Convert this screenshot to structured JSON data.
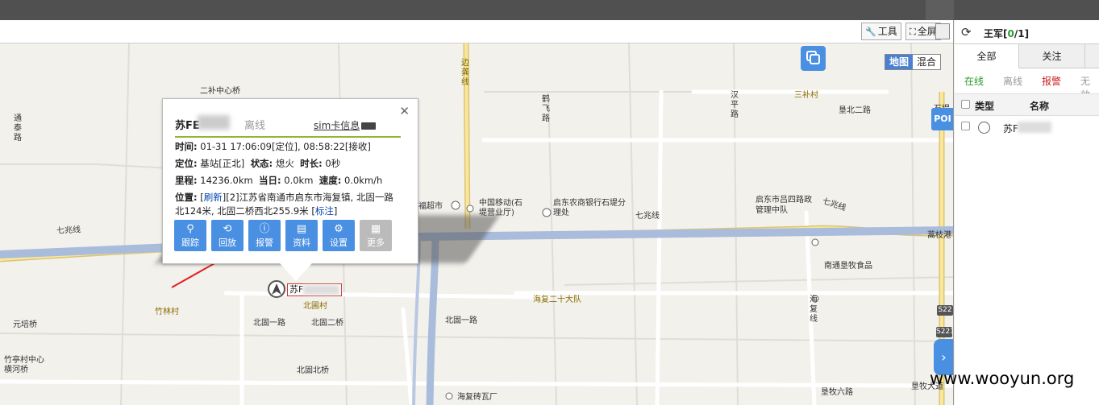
{
  "toolbar": {
    "tools_label": "工具",
    "fullscreen_label": "全屏"
  },
  "map": {
    "maptype_options": [
      "地图",
      "混合"
    ],
    "poi_label": "POI",
    "places": {
      "erbu_bridge": "二补中心桥",
      "tongtai_road": "通泰路",
      "bianyong_line": "边龚线",
      "hefei_road": "鹤飞路",
      "hanping_road": "汉平路",
      "sanbu_village": "三补村",
      "kenbei_2nd_road": "垦北二路",
      "shiti": "石堤",
      "fuchao_city": "福超市",
      "china_mobile": "中国移动(石堤营业厅)",
      "qidong_rural": "启东农商银行石堤分理处",
      "qidong_lvsi": "启东市吕四路政管理中队",
      "qizhao_line_1": "七兆线",
      "qizhao_line_2": "七兆线",
      "qizhao_line_3": "七兆线",
      "genzhi_port": "蒿枝港",
      "nantong_food": "南通垦牧食品",
      "zhulin_village": "竹林村",
      "beiguo_village": "北圃村",
      "haifu_team": "海复二十大队",
      "haifu_line": "海复线",
      "yuanpei_bridge": "元培桥",
      "beiguo_1st_a": "北固一路",
      "beiguo_2nd_bridge": "北固二桥",
      "beiguo_1st_b": "北固一路",
      "zhuting_village": "竹亭村中心横河桥",
      "beiguo_north_bridge": "北固北桥",
      "haifu_brick": "海复砖瓦厂",
      "kenmu_6th_road": "垦牧六路",
      "kenmu_ave": "垦牧大道"
    },
    "shields": [
      "S22",
      "S221"
    ],
    "marker_label": "苏F"
  },
  "popup": {
    "name": "苏FE",
    "status": "离线",
    "sim_label": "sim卡信息",
    "time_key": "时间:",
    "time_value": "01-31 17:06:09[定位], 08:58:22[接收]",
    "locate_key": "定位:",
    "locate_value": "基站[正北]",
    "state_key": "状态:",
    "state_value": "熄火",
    "duration_key": "时长:",
    "duration_value": "0秒",
    "mileage_key": "里程:",
    "mileage_value": "14236.0km",
    "today_key": "当日:",
    "today_value": "0.0km",
    "speed_key": "速度:",
    "speed_value": "0.0km/h",
    "position_key": "位置:",
    "refresh_label": "刷新",
    "position_value_1": "[2]江苏省南通市启东市海复镇, 北固一路",
    "position_value_2": "北124米, 北固二桥西北255.9米",
    "mark_label": "标注",
    "actions": [
      "跟踪",
      "回放",
      "报警",
      "资料",
      "设置",
      "更多"
    ]
  },
  "panel": {
    "user": "王军",
    "count_online": "0",
    "count_total": "1",
    "tabs": [
      "全部",
      "关注"
    ],
    "filters": [
      {
        "label": "在线",
        "color": "#2a9d2a"
      },
      {
        "label": "离线",
        "color": "#999999"
      },
      {
        "label": "报警",
        "color": "#cc2222"
      },
      {
        "label": "无效",
        "color": "#999999"
      }
    ],
    "columns": [
      "类型",
      "名称"
    ],
    "rows": [
      {
        "name": "苏F"
      }
    ]
  },
  "watermark": "www.wooyun.org"
}
